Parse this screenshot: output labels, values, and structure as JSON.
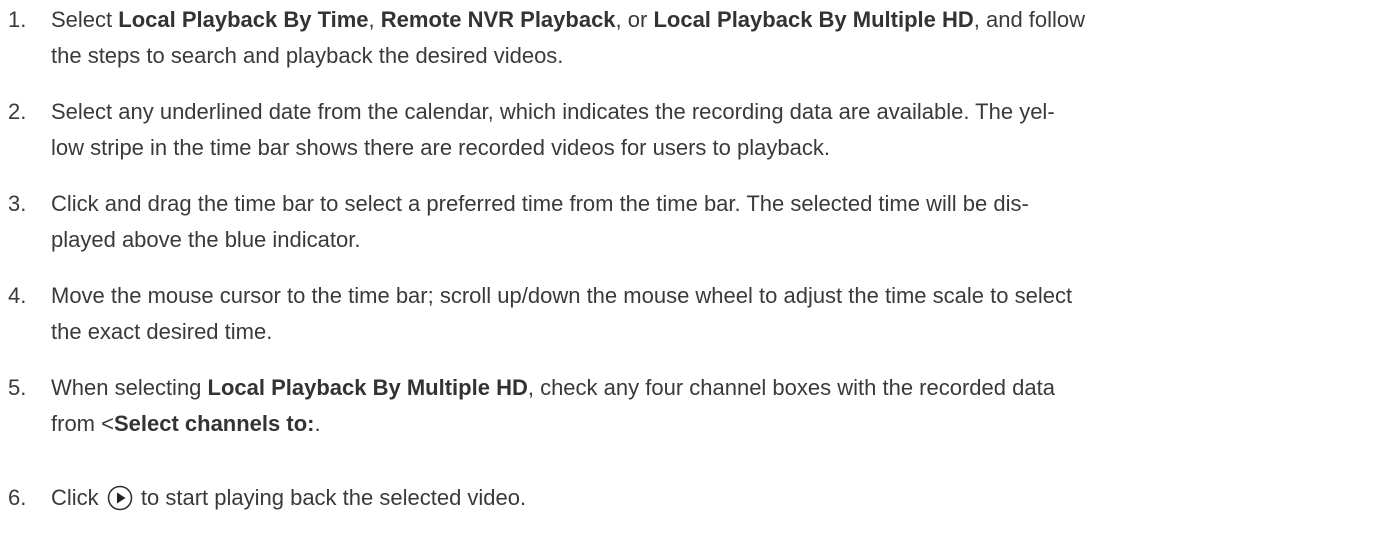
{
  "steps": [
    {
      "number": "1.",
      "lines": [
        [
          {
            "t": "Select ",
            "b": false
          },
          {
            "t": "Local Playback By Time",
            "b": true
          },
          {
            "t": ", ",
            "b": false
          },
          {
            "t": "Remote NVR Playback",
            "b": true
          },
          {
            "t": ", or ",
            "b": false
          },
          {
            "t": "Local Playback By Multiple HD",
            "b": true
          },
          {
            "t": ", and follow",
            "b": false
          }
        ],
        [
          {
            "t": "the steps to search and playback the desired videos.",
            "b": false
          }
        ]
      ]
    },
    {
      "number": "2.",
      "lines": [
        [
          {
            "t": "Select any underlined date from the calendar, which indicates the recording data are available. The yel-",
            "b": false
          }
        ],
        [
          {
            "t": "low stripe in the time bar shows there are recorded videos for users to playback.",
            "b": false
          }
        ]
      ]
    },
    {
      "number": "3.",
      "lines": [
        [
          {
            "t": "Click and drag the time bar to select a preferred time from the time bar. The selected time will be dis-",
            "b": false
          }
        ],
        [
          {
            "t": "played above the blue indicator.",
            "b": false
          }
        ]
      ]
    },
    {
      "number": "4.",
      "lines": [
        [
          {
            "t": "Move the mouse cursor to the time bar; scroll up/down the mouse wheel to adjust the time scale to select",
            "b": false
          }
        ],
        [
          {
            "t": "the exact desired time.",
            "b": false
          }
        ]
      ]
    },
    {
      "number": "5.",
      "lines": [
        [
          {
            "t": "When selecting ",
            "b": false
          },
          {
            "t": "Local Playback By Multiple HD",
            "b": true
          },
          {
            "t": ", check any four channel boxes with the recorded data",
            "b": false
          }
        ],
        [
          {
            "t": "from <",
            "b": false
          },
          {
            "t": "Select channels to:",
            "b": true
          },
          {
            "t": ".",
            "b": false
          }
        ]
      ]
    },
    {
      "number": "6.",
      "lines": [
        [
          {
            "t": "Click ",
            "b": false
          },
          {
            "icon": "play-circle-icon"
          },
          {
            "t": " to start playing back the selected video.",
            "b": false
          }
        ]
      ]
    }
  ]
}
